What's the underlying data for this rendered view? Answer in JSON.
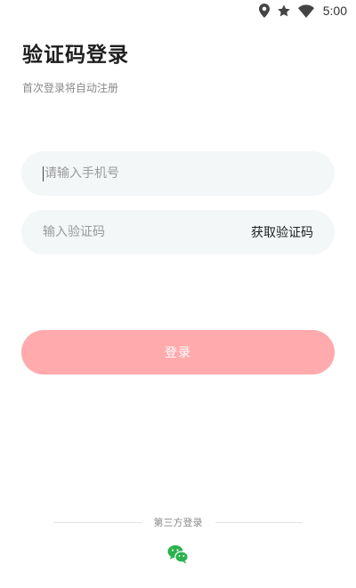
{
  "status_bar": {
    "time": "5:00",
    "icons": [
      "location-icon",
      "star-icon",
      "wifi-icon"
    ]
  },
  "page": {
    "title": "验证码登录",
    "subtitle": "首次登录将自动注册"
  },
  "form": {
    "phone_placeholder": "请输入手机号",
    "phone_value": "",
    "code_placeholder": "输入验证码",
    "code_value": "",
    "get_code_label": "获取验证码",
    "login_label": "登录"
  },
  "third_party": {
    "label": "第三方登录",
    "icon": "wechat-icon"
  },
  "colors": {
    "login_button": "#ffaaac",
    "field_background": "#f3f7f7",
    "wechat": "#2ab24c"
  }
}
